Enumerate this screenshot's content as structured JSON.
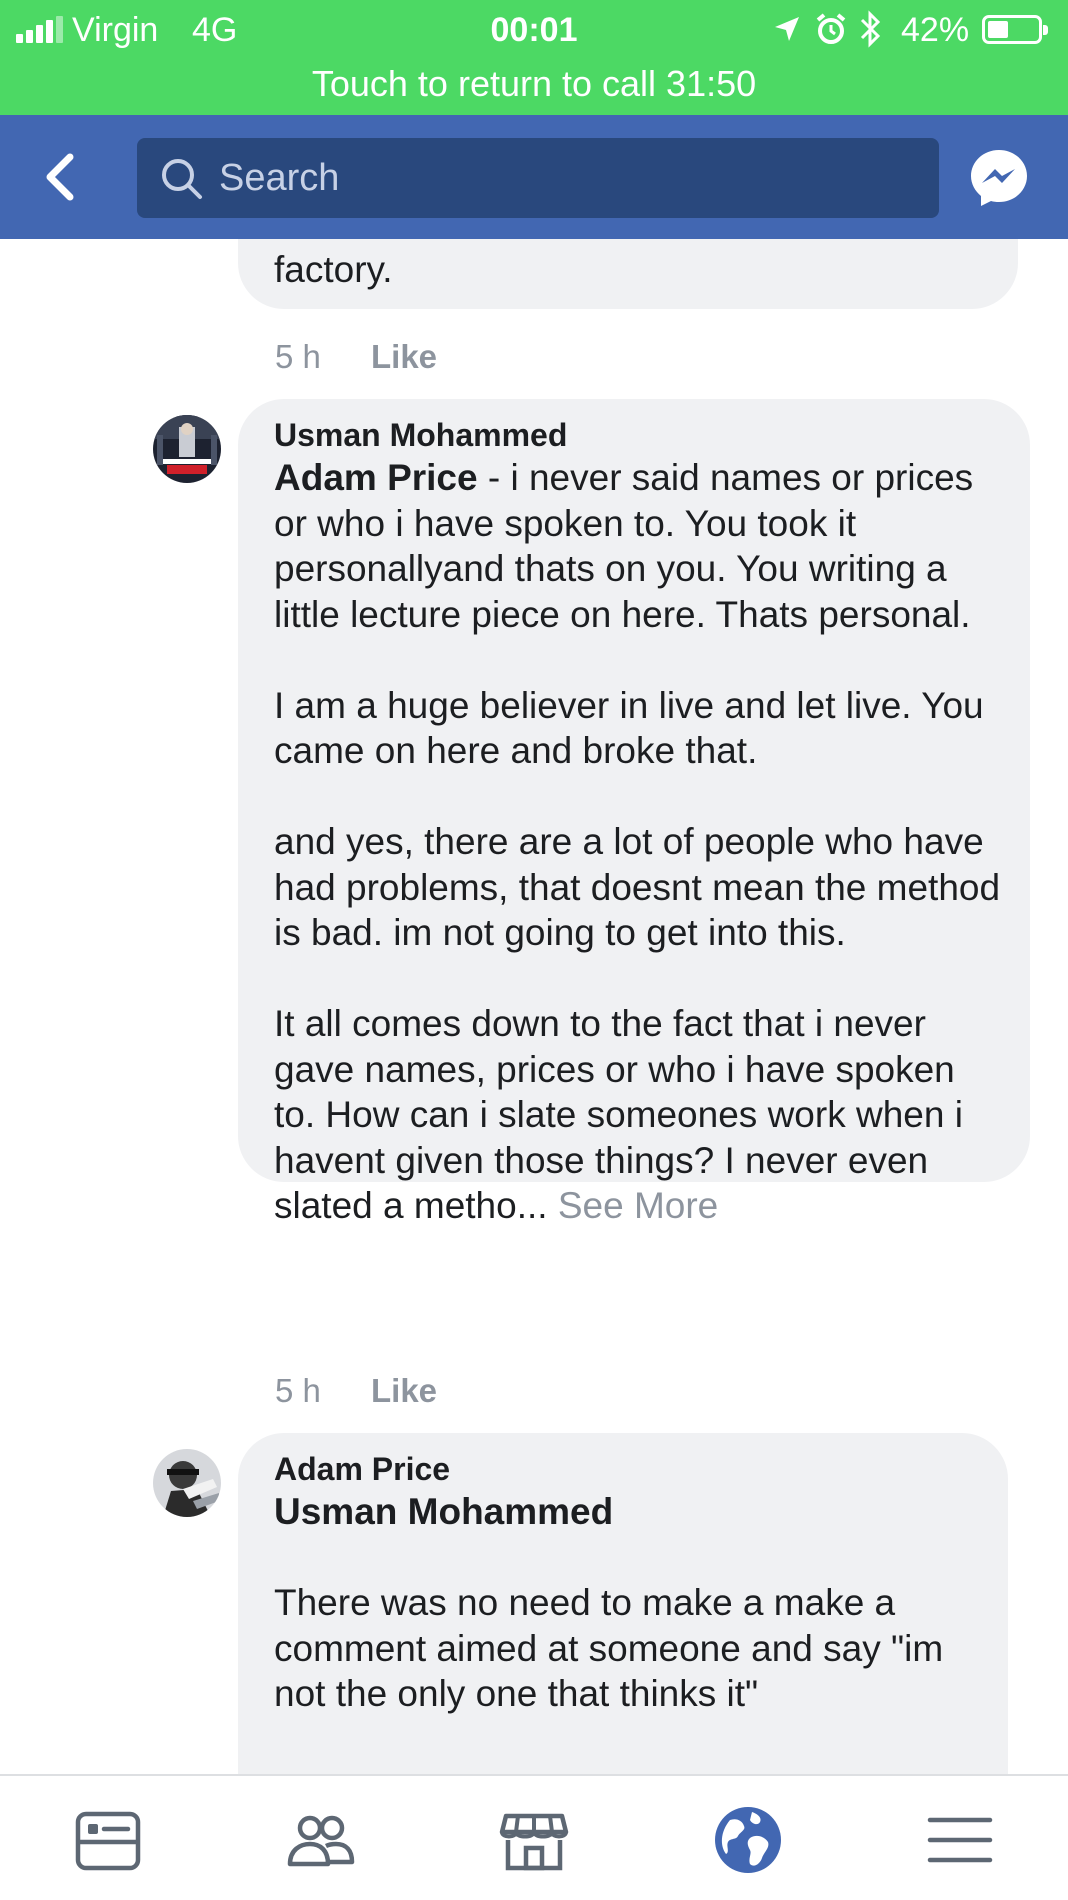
{
  "status_bar": {
    "carrier": "Virgin",
    "network": "4G",
    "time": "00:01",
    "battery_percent": "42%",
    "battery_level": 0.42,
    "icons": [
      "signal-icon",
      "location-arrow-icon",
      "alarm-icon",
      "bluetooth-icon",
      "battery-icon"
    ],
    "call_banner": "Touch to return to call 31:50",
    "color": "#4cd964"
  },
  "header": {
    "back_icon": "chevron-left-icon",
    "search_placeholder": "Search",
    "messenger_icon": "messenger-icon",
    "color": "#4267b2"
  },
  "comments": [
    {
      "truncated_text": "factory.",
      "time": "5 h",
      "like_label": "Like"
    },
    {
      "author": "Usman Mohammed",
      "mention": "Adam Price",
      "intro": " - i never said names or prices or who i have spoken to. You took it personallyand thats on you. You writing a little lecture piece on here. Thats personal.",
      "paragraphs": [
        "I am a huge believer in live and let live. You came on here and broke that.",
        "and yes, there are a lot of people who have had problems, that doesnt mean the method is bad. im not going to get into this.",
        "It all comes down to the fact that i never gave names, prices or who i have spoken to. How can i slate someones work when i havent given those things? I never even slated a metho..."
      ],
      "see_more": "See More",
      "time": "5 h",
      "like_label": "Like"
    },
    {
      "author": "Adam Price",
      "mention": "Usman Mohammed",
      "paragraphs": [
        "There was no need to make a make a comment aimed at someone and say \"im not the only one that thinks it\""
      ]
    }
  ],
  "tab_bar": {
    "tabs": [
      "news-feed-icon",
      "friends-icon",
      "marketplace-icon",
      "notifications-globe-icon",
      "menu-icon"
    ],
    "active_tab": "notifications-globe-icon",
    "active_color": "#4267b2",
    "inactive_color": "#5d6773"
  }
}
